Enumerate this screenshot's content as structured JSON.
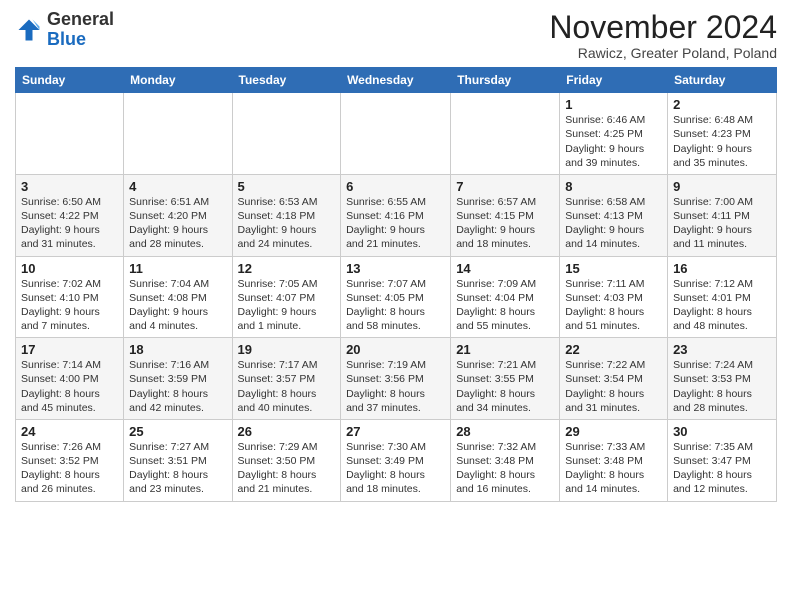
{
  "header": {
    "logo_general": "General",
    "logo_blue": "Blue",
    "month_title": "November 2024",
    "location": "Rawicz, Greater Poland, Poland"
  },
  "weekdays": [
    "Sunday",
    "Monday",
    "Tuesday",
    "Wednesday",
    "Thursday",
    "Friday",
    "Saturday"
  ],
  "weeks": [
    [
      {
        "day": "",
        "info": ""
      },
      {
        "day": "",
        "info": ""
      },
      {
        "day": "",
        "info": ""
      },
      {
        "day": "",
        "info": ""
      },
      {
        "day": "",
        "info": ""
      },
      {
        "day": "1",
        "info": "Sunrise: 6:46 AM\nSunset: 4:25 PM\nDaylight: 9 hours\nand 39 minutes."
      },
      {
        "day": "2",
        "info": "Sunrise: 6:48 AM\nSunset: 4:23 PM\nDaylight: 9 hours\nand 35 minutes."
      }
    ],
    [
      {
        "day": "3",
        "info": "Sunrise: 6:50 AM\nSunset: 4:22 PM\nDaylight: 9 hours\nand 31 minutes."
      },
      {
        "day": "4",
        "info": "Sunrise: 6:51 AM\nSunset: 4:20 PM\nDaylight: 9 hours\nand 28 minutes."
      },
      {
        "day": "5",
        "info": "Sunrise: 6:53 AM\nSunset: 4:18 PM\nDaylight: 9 hours\nand 24 minutes."
      },
      {
        "day": "6",
        "info": "Sunrise: 6:55 AM\nSunset: 4:16 PM\nDaylight: 9 hours\nand 21 minutes."
      },
      {
        "day": "7",
        "info": "Sunrise: 6:57 AM\nSunset: 4:15 PM\nDaylight: 9 hours\nand 18 minutes."
      },
      {
        "day": "8",
        "info": "Sunrise: 6:58 AM\nSunset: 4:13 PM\nDaylight: 9 hours\nand 14 minutes."
      },
      {
        "day": "9",
        "info": "Sunrise: 7:00 AM\nSunset: 4:11 PM\nDaylight: 9 hours\nand 11 minutes."
      }
    ],
    [
      {
        "day": "10",
        "info": "Sunrise: 7:02 AM\nSunset: 4:10 PM\nDaylight: 9 hours\nand 7 minutes."
      },
      {
        "day": "11",
        "info": "Sunrise: 7:04 AM\nSunset: 4:08 PM\nDaylight: 9 hours\nand 4 minutes."
      },
      {
        "day": "12",
        "info": "Sunrise: 7:05 AM\nSunset: 4:07 PM\nDaylight: 9 hours\nand 1 minute."
      },
      {
        "day": "13",
        "info": "Sunrise: 7:07 AM\nSunset: 4:05 PM\nDaylight: 8 hours\nand 58 minutes."
      },
      {
        "day": "14",
        "info": "Sunrise: 7:09 AM\nSunset: 4:04 PM\nDaylight: 8 hours\nand 55 minutes."
      },
      {
        "day": "15",
        "info": "Sunrise: 7:11 AM\nSunset: 4:03 PM\nDaylight: 8 hours\nand 51 minutes."
      },
      {
        "day": "16",
        "info": "Sunrise: 7:12 AM\nSunset: 4:01 PM\nDaylight: 8 hours\nand 48 minutes."
      }
    ],
    [
      {
        "day": "17",
        "info": "Sunrise: 7:14 AM\nSunset: 4:00 PM\nDaylight: 8 hours\nand 45 minutes."
      },
      {
        "day": "18",
        "info": "Sunrise: 7:16 AM\nSunset: 3:59 PM\nDaylight: 8 hours\nand 42 minutes."
      },
      {
        "day": "19",
        "info": "Sunrise: 7:17 AM\nSunset: 3:57 PM\nDaylight: 8 hours\nand 40 minutes."
      },
      {
        "day": "20",
        "info": "Sunrise: 7:19 AM\nSunset: 3:56 PM\nDaylight: 8 hours\nand 37 minutes."
      },
      {
        "day": "21",
        "info": "Sunrise: 7:21 AM\nSunset: 3:55 PM\nDaylight: 8 hours\nand 34 minutes."
      },
      {
        "day": "22",
        "info": "Sunrise: 7:22 AM\nSunset: 3:54 PM\nDaylight: 8 hours\nand 31 minutes."
      },
      {
        "day": "23",
        "info": "Sunrise: 7:24 AM\nSunset: 3:53 PM\nDaylight: 8 hours\nand 28 minutes."
      }
    ],
    [
      {
        "day": "24",
        "info": "Sunrise: 7:26 AM\nSunset: 3:52 PM\nDaylight: 8 hours\nand 26 minutes."
      },
      {
        "day": "25",
        "info": "Sunrise: 7:27 AM\nSunset: 3:51 PM\nDaylight: 8 hours\nand 23 minutes."
      },
      {
        "day": "26",
        "info": "Sunrise: 7:29 AM\nSunset: 3:50 PM\nDaylight: 8 hours\nand 21 minutes."
      },
      {
        "day": "27",
        "info": "Sunrise: 7:30 AM\nSunset: 3:49 PM\nDaylight: 8 hours\nand 18 minutes."
      },
      {
        "day": "28",
        "info": "Sunrise: 7:32 AM\nSunset: 3:48 PM\nDaylight: 8 hours\nand 16 minutes."
      },
      {
        "day": "29",
        "info": "Sunrise: 7:33 AM\nSunset: 3:48 PM\nDaylight: 8 hours\nand 14 minutes."
      },
      {
        "day": "30",
        "info": "Sunrise: 7:35 AM\nSunset: 3:47 PM\nDaylight: 8 hours\nand 12 minutes."
      }
    ]
  ]
}
